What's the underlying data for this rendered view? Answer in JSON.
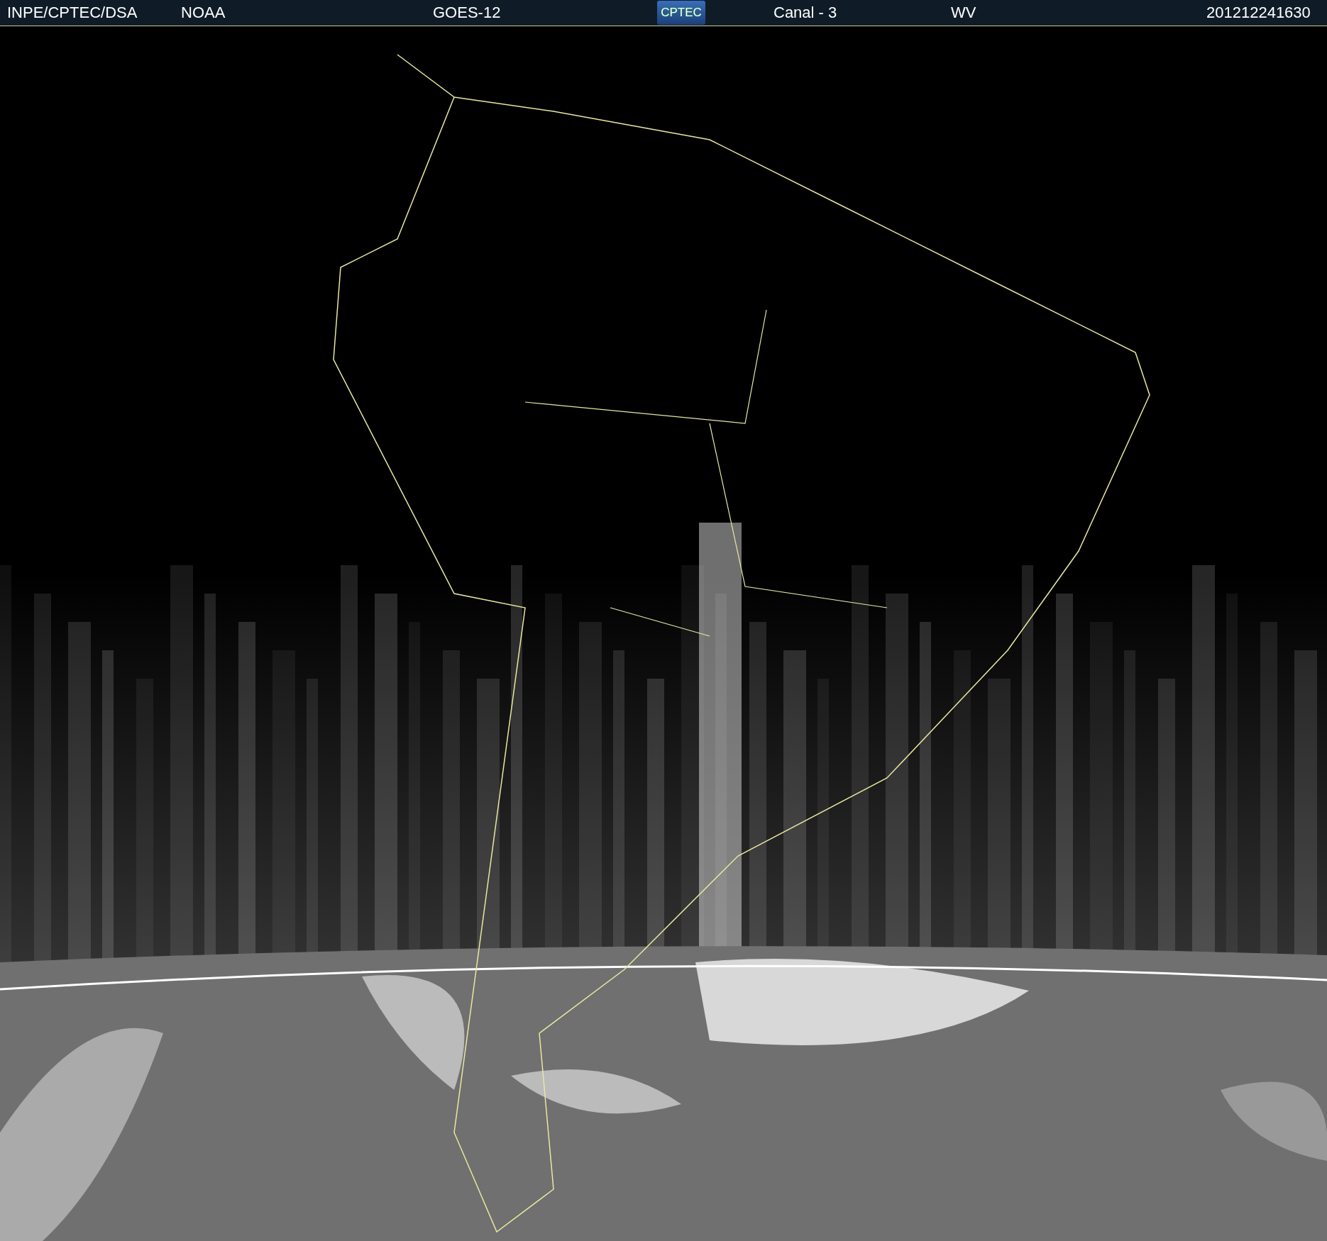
{
  "header": {
    "items": [
      {
        "kind": "text",
        "label": "INPE/CPTEC/DSA"
      },
      {
        "kind": "text",
        "label": "NOAA"
      },
      {
        "kind": "text",
        "label": "GOES-12"
      },
      {
        "kind": "logo",
        "label": "CPTEC"
      },
      {
        "kind": "text",
        "label": "Canal - 3"
      },
      {
        "kind": "text",
        "label": "WV"
      },
      {
        "kind": "text",
        "label": "201212241630"
      }
    ]
  }
}
